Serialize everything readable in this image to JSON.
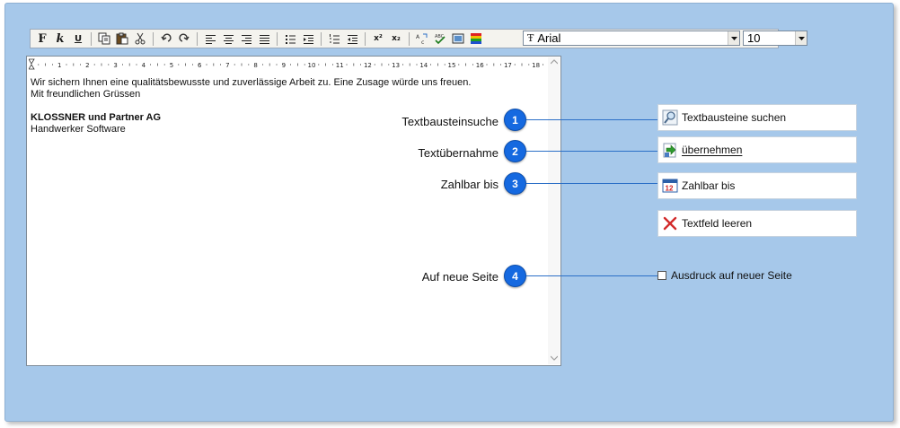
{
  "toolbar": {
    "bold_glyph": "F",
    "italic_glyph": "k",
    "underline_glyph": "U",
    "font": {
      "value": "Arial",
      "glyph": "Ŧ"
    },
    "size": {
      "value": "10"
    }
  },
  "editor": {
    "ruler_numbers": [
      "1",
      "2",
      "3",
      "4",
      "5",
      "6",
      "7",
      "8",
      "9",
      "10",
      "11",
      "12",
      "13",
      "14",
      "15",
      "16",
      "17",
      "18"
    ],
    "lines": [
      "Wir sichern Ihnen eine qualitätsbewusste und zuverlässige Arbeit zu. Eine Zusage würde uns freuen.",
      "Mit freundlichen Grüssen",
      "",
      "KLOSSNER und Partner AG",
      "Handwerker Software"
    ]
  },
  "callouts": [
    {
      "number": "1",
      "label": "Textbausteinsuche"
    },
    {
      "number": "2",
      "label": "Textübernahme"
    },
    {
      "number": "3",
      "label": "Zahlbar bis"
    },
    {
      "number": "4",
      "label": "Auf neue Seite"
    }
  ],
  "buttons": {
    "search": {
      "label": "Textbausteine suchen",
      "icon": "magnifier-icon"
    },
    "accept": {
      "label": "übernehmen",
      "icon": "accept-icon"
    },
    "due": {
      "label": "Zahlbar bis",
      "icon": "calendar-icon",
      "icon_text": "12"
    },
    "clear": {
      "label": "Textfeld leeren",
      "icon": "red-x-icon"
    }
  },
  "new_page_checkbox": {
    "label": "Ausdruck auf neuer Seite",
    "checked": false
  },
  "colors": {
    "panel_bg": "#a6c8ea",
    "badge": "#1569e0",
    "connector": "#2b6fc7",
    "clear_x": "#d22a2a"
  }
}
